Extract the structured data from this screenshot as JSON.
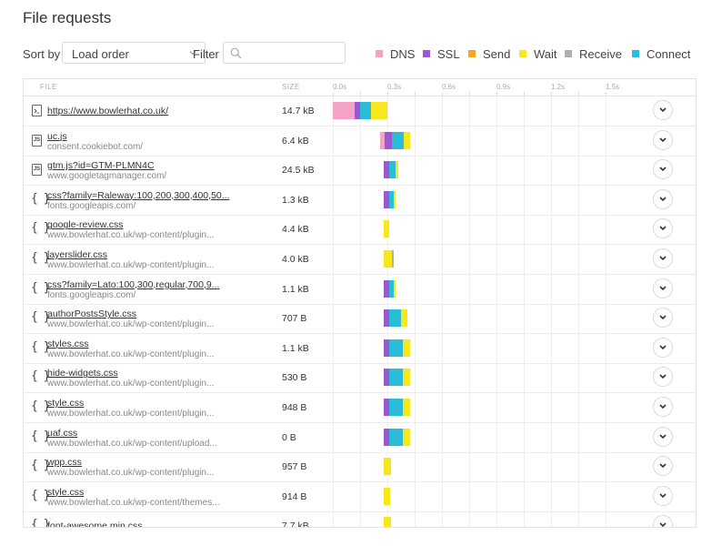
{
  "title": "File requests",
  "toolbar": {
    "sort_label": "Sort by",
    "sort_value": "Load order",
    "filter_label": "Filter",
    "filter_value": ""
  },
  "legend": [
    {
      "label": "DNS",
      "color": "#f5a3c7"
    },
    {
      "label": "SSL",
      "color": "#9b59d0"
    },
    {
      "label": "Send",
      "color": "#f5a623"
    },
    {
      "label": "Wait",
      "color": "#f8e71c"
    },
    {
      "label": "Receive",
      "color": "#b0b0b0"
    },
    {
      "label": "Connect",
      "color": "#2bbcd8"
    }
  ],
  "table": {
    "columns": {
      "file": "FILE",
      "size": "SIZE"
    },
    "ticks": [
      "0.0s",
      "0.3s",
      "0.6s",
      "0.9s",
      "1.2s",
      "1.5s"
    ],
    "rows": [
      {
        "icon": "page-icon",
        "icon_text": "",
        "name": "https://www.bowlerhat.co.uk/",
        "host": "",
        "size": "14.7 kB",
        "timing": {
          "start": 0.0,
          "dns": 0.12,
          "ssl": 0.03,
          "connect": 0.06,
          "wait": 0.09
        }
      },
      {
        "icon": "js-file-icon",
        "icon_text": "JS",
        "name": "uc.js",
        "host": "consent.cookiebot.com/",
        "size": "6.4 kB",
        "timing": {
          "start": 0.26,
          "dns": 0.025,
          "ssl": 0.04,
          "connect": 0.065,
          "wait": 0.035
        }
      },
      {
        "icon": "js-file-icon",
        "icon_text": "JS",
        "name": "gtm.js?id=GTM-PLMN4C",
        "host": "www.googletagmanager.com/",
        "size": "24.5 kB",
        "timing": {
          "start": 0.28,
          "ssl": 0.03,
          "connect": 0.035,
          "wait": 0.015
        }
      },
      {
        "icon": "css-braces-icon",
        "icon_text": "",
        "name": "css?family=Raleway:100,200,300,400,50...",
        "host": "fonts.googleapis.com/",
        "size": "1.3 kB",
        "timing": {
          "start": 0.28,
          "ssl": 0.03,
          "connect": 0.025,
          "wait": 0.01
        }
      },
      {
        "icon": "css-braces-icon",
        "icon_text": "",
        "name": "google-review.css",
        "host": "www.bowlerhat.co.uk/wp-content/plugin...",
        "size": "4.4 kB",
        "timing": {
          "start": 0.28,
          "wait": 0.03
        }
      },
      {
        "icon": "css-braces-icon",
        "icon_text": "",
        "name": "layerslider.css",
        "host": "www.bowlerhat.co.uk/wp-content/plugin...",
        "size": "4.0 kB",
        "timing": {
          "start": 0.28,
          "wait": 0.045,
          "receive": 0.008
        }
      },
      {
        "icon": "css-braces-icon",
        "icon_text": "",
        "name": "css?family=Lato:100,300,regular,700,9...",
        "host": "fonts.googleapis.com/",
        "size": "1.1 kB",
        "timing": {
          "start": 0.28,
          "ssl": 0.03,
          "connect": 0.025,
          "wait": 0.01
        }
      },
      {
        "icon": "css-braces-icon",
        "icon_text": "",
        "name": "authorPostsStyle.css",
        "host": "www.bowlerhat.co.uk/wp-content/plugin...",
        "size": "707 B",
        "timing": {
          "start": 0.28,
          "ssl": 0.03,
          "connect": 0.065,
          "wait": 0.035
        }
      },
      {
        "icon": "css-braces-icon",
        "icon_text": "",
        "name": "styles.css",
        "host": "www.bowlerhat.co.uk/wp-content/plugin...",
        "size": "1.1 kB",
        "timing": {
          "start": 0.28,
          "ssl": 0.03,
          "connect": 0.075,
          "wait": 0.04
        }
      },
      {
        "icon": "css-braces-icon",
        "icon_text": "",
        "name": "hide-widgets.css",
        "host": "www.bowlerhat.co.uk/wp-content/plugin...",
        "size": "530 B",
        "timing": {
          "start": 0.28,
          "ssl": 0.03,
          "connect": 0.075,
          "wait": 0.04
        }
      },
      {
        "icon": "css-braces-icon",
        "icon_text": "",
        "name": "style.css",
        "host": "www.bowlerhat.co.uk/wp-content/plugin...",
        "size": "948 B",
        "timing": {
          "start": 0.28,
          "ssl": 0.03,
          "connect": 0.075,
          "wait": 0.04
        }
      },
      {
        "icon": "css-braces-icon",
        "icon_text": "",
        "name": "uaf.css",
        "host": "www.bowlerhat.co.uk/wp-content/upload...",
        "size": "0 B",
        "timing": {
          "start": 0.28,
          "ssl": 0.03,
          "connect": 0.075,
          "wait": 0.04
        }
      },
      {
        "icon": "css-braces-icon",
        "icon_text": "",
        "name": "wpp.css",
        "host": "www.bowlerhat.co.uk/wp-content/plugin...",
        "size": "957 B",
        "timing": {
          "start": 0.28,
          "wait": 0.04
        }
      },
      {
        "icon": "css-braces-icon",
        "icon_text": "",
        "name": "style.css",
        "host": "www.bowlerhat.co.uk/wp-content/themes...",
        "size": "914 B",
        "timing": {
          "start": 0.28,
          "wait": 0.035
        }
      },
      {
        "icon": "css-braces-icon",
        "icon_text": "",
        "name": "font-awesome.min.css",
        "host": "",
        "size": "7.7 kB",
        "timing": {
          "start": 0.28,
          "wait": 0.04
        }
      }
    ]
  }
}
